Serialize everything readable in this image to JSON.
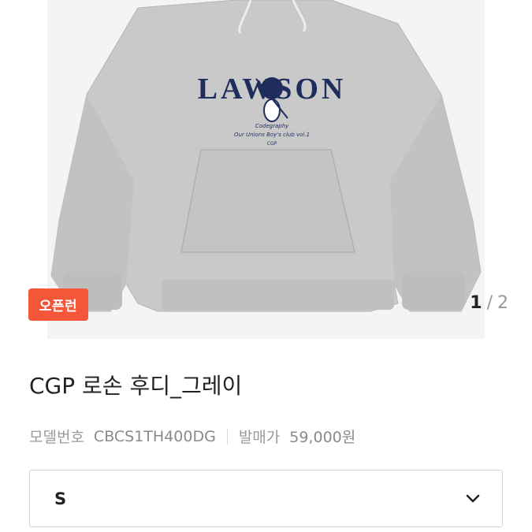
{
  "product": {
    "image_alt": "CGP 로손 후디_그레이",
    "graphic_text": "LAWSON",
    "graphic_subtext": [
      "Codegraphy",
      "Our Unions Boy's club vol.1",
      "CGP"
    ],
    "badge": "오픈런",
    "pager": {
      "current": "1",
      "separator": "/",
      "total": "2"
    },
    "title": "CGP 로손 후디_그레이",
    "model_label": "모델번호",
    "model_value": "CBCS1TH400DG",
    "release_label": "발매가",
    "release_value": "59,000원"
  },
  "size_select": {
    "value": "S"
  },
  "colors": {
    "badge": "#f4563a",
    "hoodie": "#c6c6c6",
    "print": "#1f2d5c"
  },
  "icons": {
    "chevron": "chevron-down-icon"
  }
}
